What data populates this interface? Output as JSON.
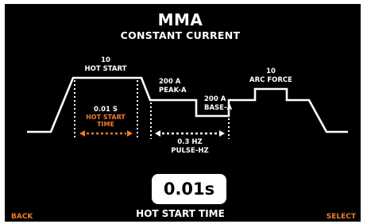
{
  "header": {
    "title": "MMA",
    "subtitle": "CONSTANT CURRENT"
  },
  "waveform": {
    "hot_start": {
      "value": "10",
      "label": "HOT START"
    },
    "hot_start_time": {
      "value": "0.01 S",
      "label": "HOT START TIME"
    },
    "peak": {
      "value": "200 A",
      "label": "PEAK-A"
    },
    "base": {
      "value": "200 A",
      "label": "BASE-A"
    },
    "pulse": {
      "value": "0.3 HZ",
      "label": "PULSE-HZ"
    },
    "arc_force": {
      "value": "10",
      "label": "ARC FORCE"
    }
  },
  "selected_parameter": {
    "value": "0.01s",
    "label": "HOT START TIME"
  },
  "softkeys": {
    "back": "BACK",
    "select": "SELECT"
  },
  "colors": {
    "background": "#000000",
    "foreground": "#ffffff",
    "accent": "#f07a2a"
  }
}
